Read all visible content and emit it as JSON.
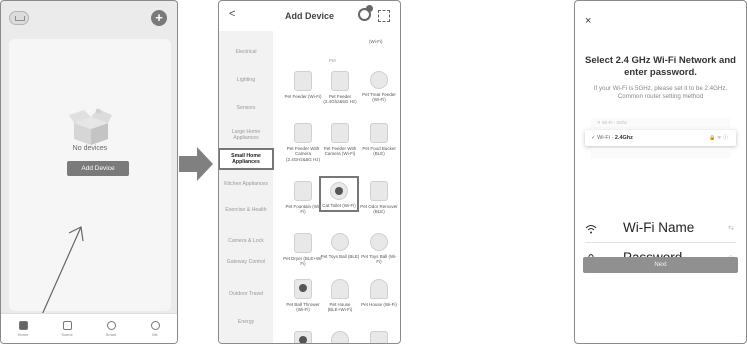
{
  "screen1": {
    "empty_state": "No devices",
    "add_device_button": "Add Device",
    "nav": [
      {
        "label": "Home",
        "icon": "home-icon"
      },
      {
        "label": "Scene",
        "icon": "checkbox-icon"
      },
      {
        "label": "Smart",
        "icon": "smart-icon"
      },
      {
        "label": "Me",
        "icon": "profile-icon"
      }
    ]
  },
  "screen2": {
    "back": "<",
    "title": "Add Device",
    "categories": [
      "Electrical",
      "Lighting",
      "Sensors",
      "Large Home Appliances",
      "Small Home Appliances",
      "Kitchen Appliances",
      "Exercise & Health",
      "Camera & Lock",
      "Gateway Control",
      "Outdoor Travel",
      "Energy"
    ],
    "selected_category": "Small Home Appliances",
    "header_wifi": "(Wi-Fi)",
    "section_title": "Pet",
    "products": [
      "Pet Feeder (Wi-Fi)",
      "Pet Feeder (2.4Ghz&5G Hz)",
      "Pet Treat Feeder (Wi-Fi)",
      "Pet Feeder With Camera (2.4GHz&5G Hz)",
      "Pet Feeder With Camera (Wi-Fi)",
      "Pet Food Bucket (BLE)",
      "Pet Fountain (Wi-Fi)",
      "Cat Toilet (Wi-Fi)",
      "Pet Odor Remover (BLE)",
      "Pet Dryer (BLE+Wi-Fi)",
      "Pet Toys Ball (BLE)",
      "Pet Toys Ball (Wi-Fi)",
      "Pet Ball Thrower (Wi-Fi)",
      "Pet House (BLE+Wi-Fi)",
      "Pet House (Wi-Fi)"
    ],
    "highlighted_product": "Cat Toilet (Wi-Fi)"
  },
  "screen3": {
    "close": "×",
    "title": "Select 2.4 GHz Wi-Fi Network and enter password.",
    "subtitle": "If your Wi-Fi is 5GHz, please set it to be 2.4GHz. Common router setting method",
    "wifi_5g": "✕ Wi-Fi - 5Ghz",
    "wifi_24_prefix": "✓ Wi-Fi - ",
    "wifi_24_band": "2.4Ghz",
    "wifi_24_icons": "🔒 ᯤ ⓘ",
    "wifi_name_placeholder": "Wi-Fi Name",
    "password_placeholder": "Password",
    "swap_icon_glyph": "⇆",
    "eye_icon_glyph": "◎",
    "next_button": "Next"
  }
}
